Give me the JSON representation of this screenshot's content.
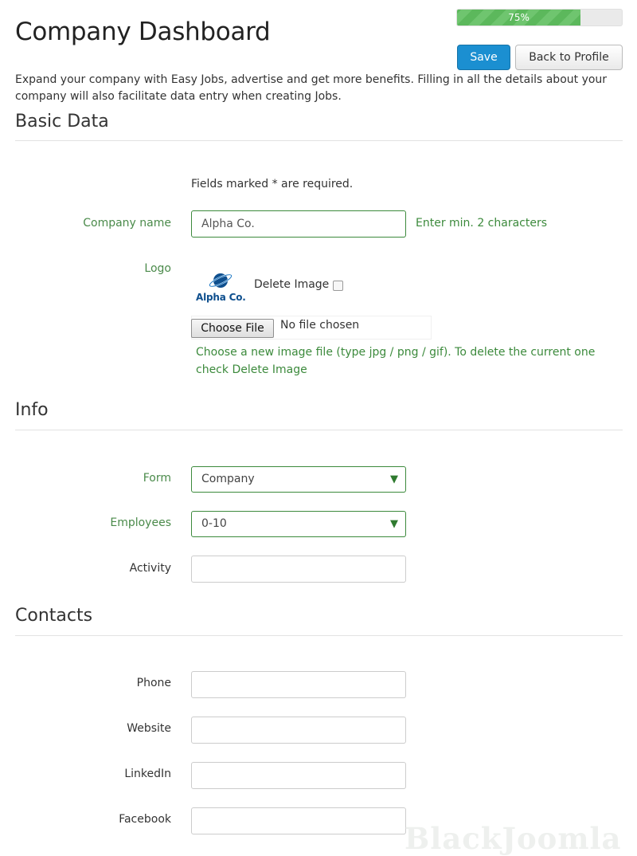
{
  "header": {
    "title": "Company Dashboard",
    "progress_label": "75%",
    "progress_value": 0.75,
    "save_label": "Save",
    "back_label": "Back to Profile",
    "intro": "Expand your company with Easy Jobs, advertise and get more benefits. Filling in all the details about your company will also facilitate data entry when creating Jobs."
  },
  "basic": {
    "title": "Basic Data",
    "required_note": "Fields marked * are required.",
    "company_name_label": "Company name",
    "company_name_value": "Alpha Co.",
    "company_name_hint": "Enter min. 2 characters",
    "logo_label": "Logo",
    "logo_text": "Alpha Co.",
    "delete_image_label": "Delete Image",
    "choose_file_label": "Choose File",
    "file_status": "No file chosen",
    "file_hint": "Choose a new image file (type jpg / png / gif). To delete the current one check Delete Image"
  },
  "info": {
    "title": "Info",
    "form_label": "Form",
    "form_value": "Company",
    "employees_label": "Employees",
    "employees_value": "0-10",
    "activity_label": "Activity",
    "activity_value": ""
  },
  "contacts": {
    "title": "Contacts",
    "phone_label": "Phone",
    "website_label": "Website",
    "linkedin_label": "LinkedIn",
    "facebook_label": "Facebook"
  },
  "watermark": "BlackJoomla",
  "colors": {
    "primary": "#1b8fd1",
    "success": "#5cb85c",
    "valid_border": "#3c8a3c"
  }
}
